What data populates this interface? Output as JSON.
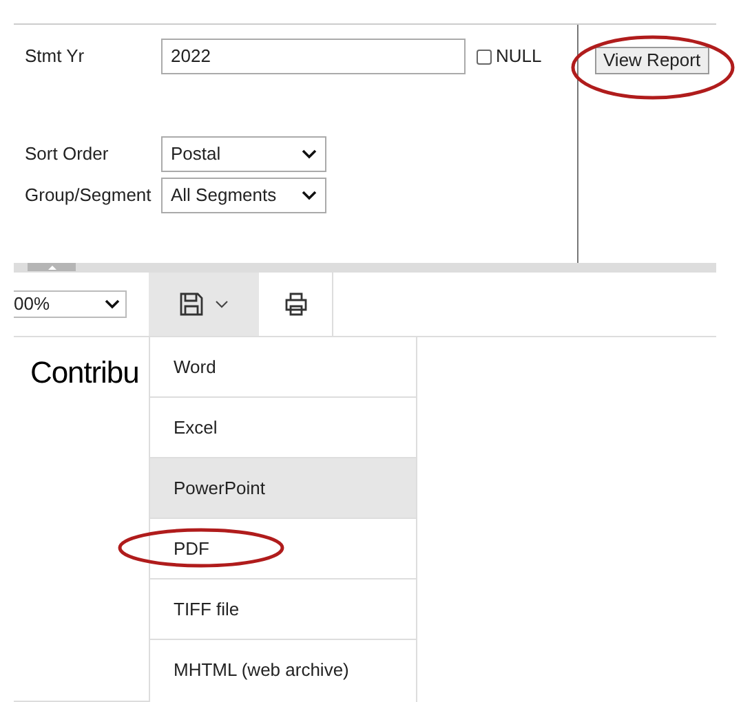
{
  "parameters": {
    "stmt_yr": {
      "label": "Stmt Yr",
      "value": "2022",
      "null_label": "NULL",
      "null_checked": false
    },
    "sort_order": {
      "label": "Sort Order",
      "value": "Postal"
    },
    "group_segment": {
      "label": "Group/Segment",
      "value": "All Segments"
    },
    "view_report": {
      "label": "View Report",
      "circled": true
    }
  },
  "toolbar": {
    "zoom": "00%",
    "save_menu_open": true
  },
  "report": {
    "title": "Contribu"
  },
  "export_menu": [
    {
      "label": "Word",
      "selected": false,
      "circled": false
    },
    {
      "label": "Excel",
      "selected": false,
      "circled": false
    },
    {
      "label": "PowerPoint",
      "selected": true,
      "circled": false
    },
    {
      "label": "PDF",
      "selected": false,
      "circled": true
    },
    {
      "label": "TIFF file",
      "selected": false,
      "circled": false
    },
    {
      "label": "MHTML (web archive)",
      "selected": false,
      "circled": false
    }
  ]
}
